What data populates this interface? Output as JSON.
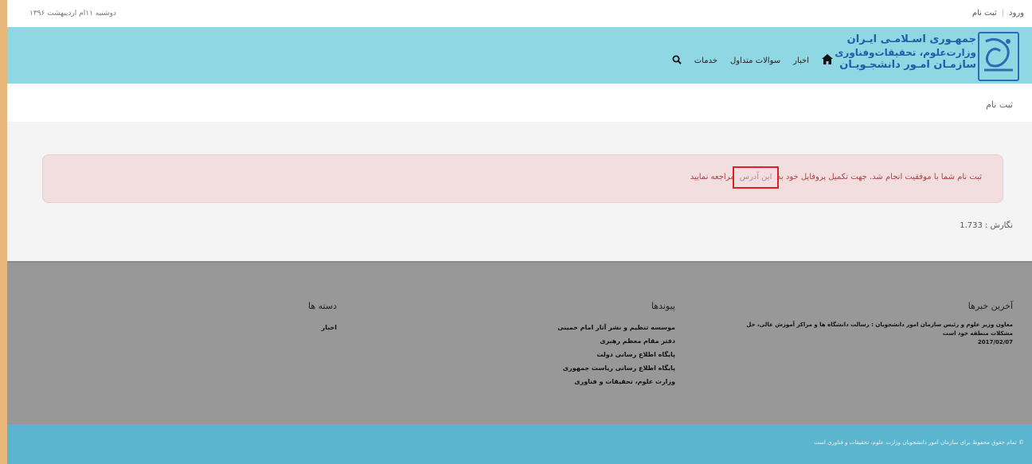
{
  "top": {
    "login": "ورود",
    "register": "ثبت نام",
    "date": "دوشنبه ۱۱ام اردیبهشت ۱۳۹۶"
  },
  "header": {
    "logo_line1": "جمهـوری اسـلامـی ایـران",
    "logo_line2": "وزارت‌علوم، تحقیقات‌وفناوری",
    "logo_line3": "سازمـان امـور دانشجـویـان",
    "logo_icon": "university-emblem-icon",
    "colors": {
      "header_bg": "#8fd7e2",
      "logo_blue": "#1f5ea8"
    }
  },
  "nav": {
    "home_icon": "home-icon",
    "items": [
      "اخبار",
      "سوالات متداول",
      "خدمات"
    ],
    "search_icon": "search-icon"
  },
  "page": {
    "title": "ثبت نام"
  },
  "alert": {
    "text_before": "ثبت نام شما با موفقیت انجام شد. جهت تکمیل پروفایل خود به",
    "link_text": "این آدرس",
    "text_after": "مراجعه نمایید",
    "colors": {
      "bg": "#f2dede",
      "text": "#a94442",
      "highlight": "#e02020"
    }
  },
  "version": {
    "label": "نگارش : 1.733"
  },
  "footer": {
    "news": {
      "title": "آخرین خبرها",
      "body": "معاون وزیر علوم و رئیس سازمان امور دانشجویان : رسالت دانشگاه ها و مراکز آموزش عالی، حل مشکلات منطقه خود است",
      "date": "2017/02/07"
    },
    "links": {
      "title": "پیوندها",
      "items": [
        "موسسه تنظیم و نشر آثار امام خمینی",
        "دفتر مقام معظم رهبری",
        "پایگاه اطلاع رسانی دولت",
        "پایگاه اطلاع رسانی ریاست جمهوری",
        "وزارت علوم، تحقیقات و فناوری"
      ]
    },
    "categories": {
      "title": "دسته ها",
      "items": [
        "اخبار"
      ]
    },
    "copyright": "© تمام حقوق محفوظ برای سازمان امور دانشجویان وزارت علوم، تحقیقات و فناوری است"
  }
}
